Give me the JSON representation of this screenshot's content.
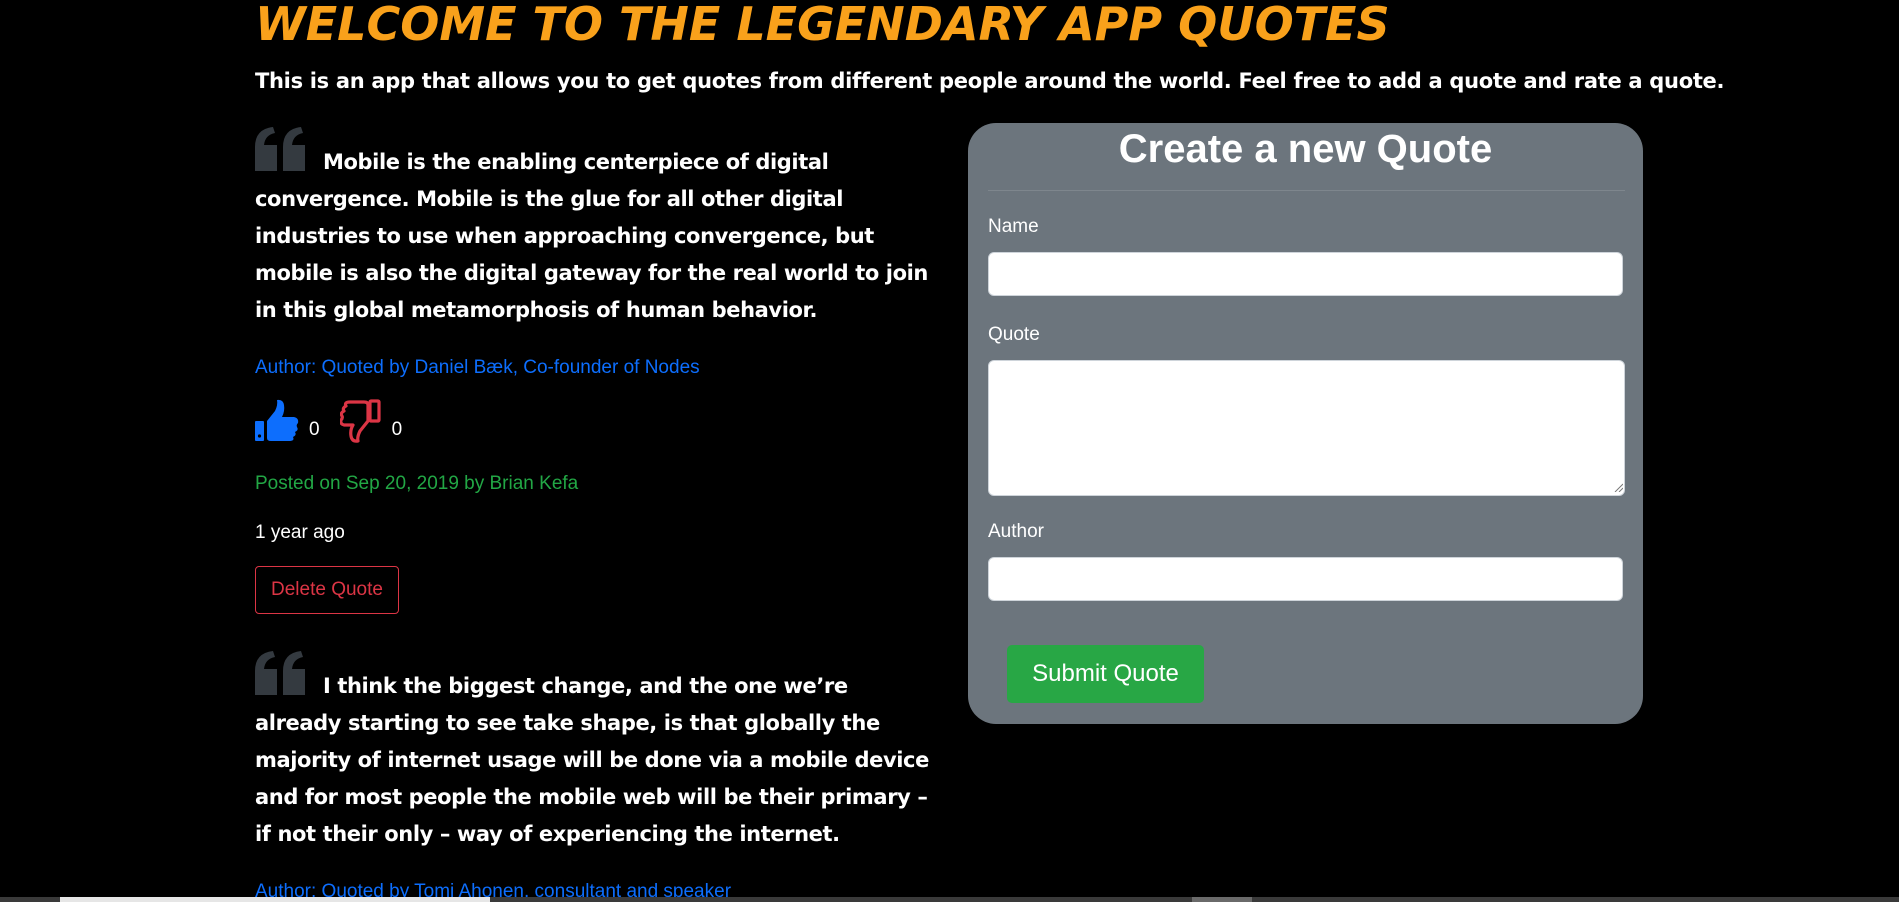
{
  "header": {
    "title": "WELCOME TO THE LEGENDARY APP QUOTES",
    "intro": "This is an app that allows you to get quotes from different people around the world. Feel free to add a quote and rate a quote."
  },
  "quotes": [
    {
      "text": "Mobile is the enabling centerpiece of digital convergence. Mobile is the glue for all other digital industries to use when approaching convergence, but mobile is also the digital gateway for the real world to join in this global metamorphosis of human behavior.",
      "author": "Author: Quoted by  Daniel Bæk, Co-founder of Nodes",
      "upvotes": "0",
      "downvotes": "0",
      "posted": "Posted on Sep 20, 2019 by Brian Kefa",
      "ago": "1 year ago",
      "delete_label": "Delete Quote"
    },
    {
      "text": "I think the biggest change, and the one we’re already starting to see take shape, is that globally the majority of internet usage will be done via a mobile device and for most people the mobile web will be their primary – if not their only – way of experiencing the internet.",
      "author": "Author: Quoted by Tomi Ahonen, consultant and speaker"
    }
  ],
  "form": {
    "title": "Create a new Quote",
    "name_label": "Name",
    "name_value": "",
    "quote_label": "Quote",
    "quote_value": "",
    "author_label": "Author",
    "author_value": "",
    "submit_label": "Submit Quote"
  },
  "icons": {
    "quote": "quote-icon",
    "upvote": "thumbs-up-icon",
    "downvote": "thumbs-down-icon"
  },
  "colors": {
    "title": "#f9a11b",
    "link": "#0d6efd",
    "posted": "#22a745",
    "danger": "#dc3545",
    "card": "#6c757d",
    "submit": "#28a745"
  }
}
